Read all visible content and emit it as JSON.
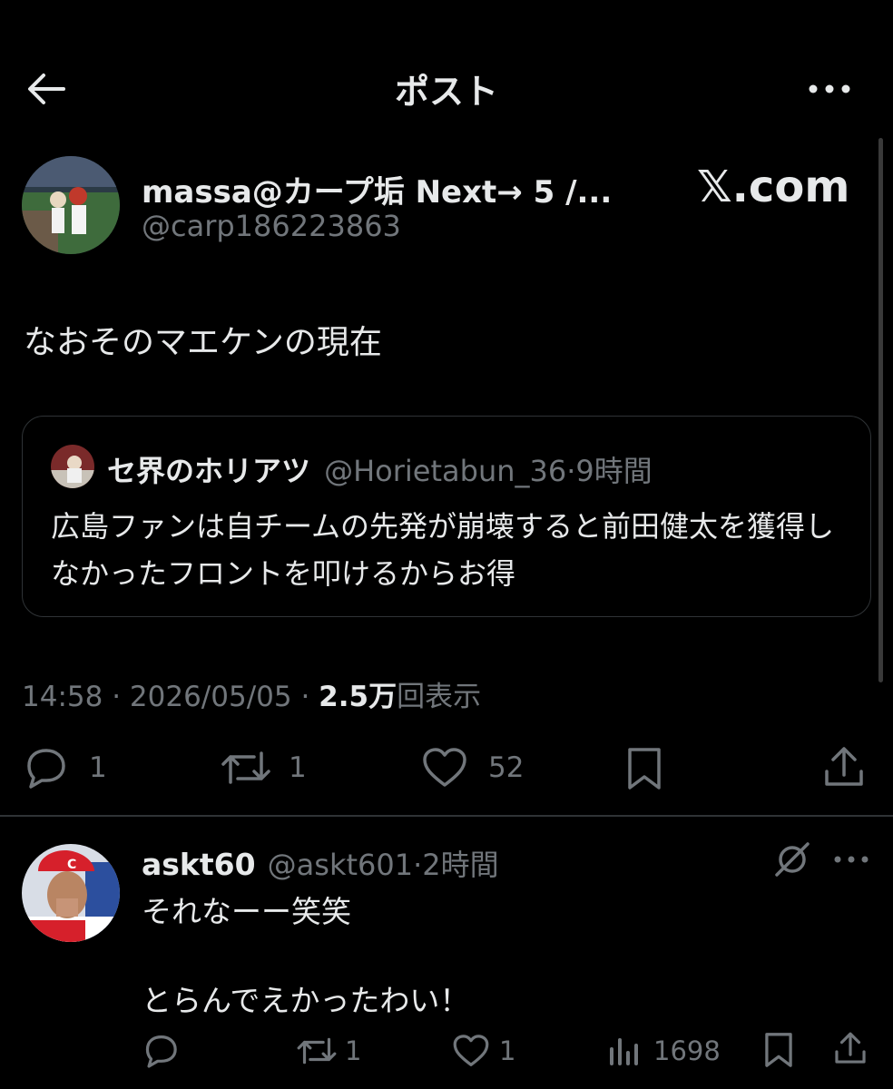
{
  "header": {
    "title": "ポスト",
    "back_icon": "arrow-left-icon",
    "more_icon": "more-horizontal-icon"
  },
  "post": {
    "author_name": "massa@カープ垢 Next→ 5 /...",
    "author_handle": "@carp186223863",
    "watermark": "𝕏.com",
    "text": "なおそのマエケンの現在",
    "quote": {
      "author_name": "セ界のホリアツ",
      "author_handle": "@Horietabun_36",
      "time": "9時間",
      "text": "広島ファンは自チームの先発が崩壊すると前田健太を獲得しなかったフロントを叩けるからお得"
    },
    "time": "14:58",
    "date": "2026/05/05",
    "views_count": "2.5万",
    "views_label": "回表示",
    "actions": {
      "replies": "1",
      "reposts": "1",
      "likes": "52"
    }
  },
  "reply": {
    "author_name": "askt60",
    "author_handle": "@askt601",
    "time": "2時間",
    "text_line1": "それなーー笑笑",
    "text_line2": "とらんでえかったわい！",
    "actions": {
      "replies": "",
      "reposts": "1",
      "likes": "1",
      "views": "1698"
    }
  },
  "colors": {
    "background": "#000000",
    "text": "#e7e9ea",
    "muted": "#71767b",
    "border": "#2f3336"
  }
}
